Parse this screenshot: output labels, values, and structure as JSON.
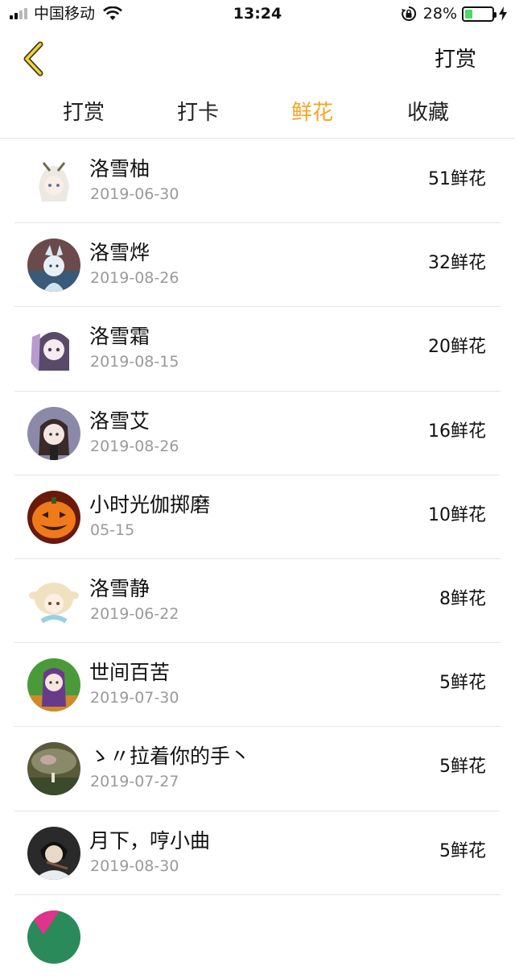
{
  "status_bar": {
    "carrier": "中国移动",
    "time": "13:24",
    "battery_percent": "28%",
    "battery_level": 0.28,
    "battery_color": "#4cd964"
  },
  "nav": {
    "back_icon": "chevron-left-icon",
    "action_label": "打赏"
  },
  "tabs": [
    {
      "label": "打赏",
      "active": false
    },
    {
      "label": "打卡",
      "active": false
    },
    {
      "label": "鲜花",
      "active": true
    },
    {
      "label": "收藏",
      "active": false
    }
  ],
  "accent_color": "#f5a623",
  "rows": [
    {
      "name": "洛雪柚",
      "date": "2019-06-30",
      "count": "51鲜花"
    },
    {
      "name": "洛雪烨",
      "date": "2019-08-26",
      "count": "32鲜花"
    },
    {
      "name": "洛雪霜",
      "date": "2019-08-15",
      "count": "20鲜花"
    },
    {
      "name": "洛雪艾",
      "date": "2019-08-26",
      "count": "16鲜花"
    },
    {
      "name": "小时光伽掷磨",
      "date": "05-15",
      "count": "10鲜花"
    },
    {
      "name": "洛雪静",
      "date": "2019-06-22",
      "count": "8鲜花"
    },
    {
      "name": "世间百苦",
      "date": "2019-07-30",
      "count": "5鲜花"
    },
    {
      "name": "ゝ〃拉着你的手丶",
      "date": "2019-07-27",
      "count": "5鲜花"
    },
    {
      "name": "月下，哼小曲",
      "date": "2019-08-30",
      "count": "5鲜花"
    }
  ]
}
